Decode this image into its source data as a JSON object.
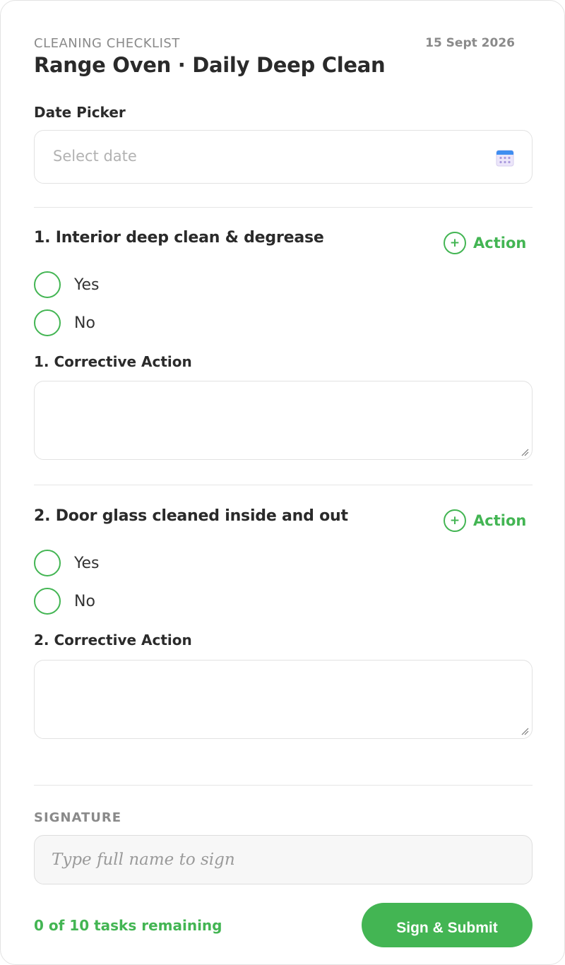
{
  "header": {
    "eyebrow": "CLEANING CHECKLIST",
    "date": "15 Sept 2026",
    "title": "Range Oven · Daily Deep Clean"
  },
  "date_picker": {
    "label": "Date Picker",
    "placeholder": "Select date",
    "icon": "calendar-icon"
  },
  "questions": [
    {
      "title": "1. Interior deep clean & degrease",
      "action_label": "Action",
      "action_icon": "plus-circle-icon",
      "options": [
        "Yes",
        "No"
      ],
      "corrective_label": "1. Corrective Action",
      "corrective_value": ""
    },
    {
      "title": "2. Door glass cleaned inside and out",
      "action_label": "Action",
      "action_icon": "plus-circle-icon",
      "options": [
        "Yes",
        "No"
      ],
      "corrective_label": "2. Corrective Action",
      "corrective_value": ""
    }
  ],
  "signature": {
    "label": "SIGNATURE",
    "placeholder": "Type full name to sign"
  },
  "footer": {
    "tasks_remaining": "0 of 10 tasks remaining",
    "submit_label": "Sign & Submit"
  },
  "colors": {
    "accent": "#43b553",
    "muted_text": "#8a8a8a",
    "border": "#e2e2e2"
  }
}
